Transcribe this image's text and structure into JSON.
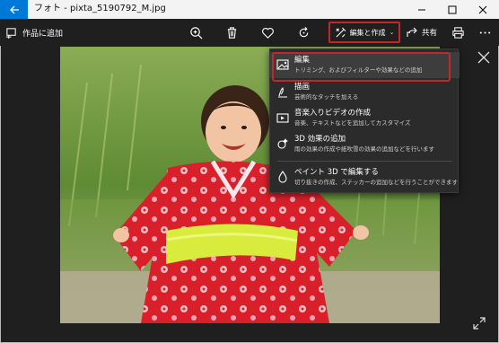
{
  "window": {
    "title": "フォト - pixta_5190792_M.jpg",
    "controls": [
      "minimize-icon",
      "maximize-icon",
      "close-icon"
    ]
  },
  "toolbar": {
    "add_to_album_label": "作品に追加",
    "icons": [
      "zoom-in-icon",
      "delete-icon",
      "favorite-heart-icon",
      "rotate-icon",
      "print-icon",
      "more-icon"
    ],
    "edit_create_label": "編集と作成",
    "share_label": "共有"
  },
  "menu": {
    "items": [
      {
        "title": "編集",
        "description": "トリミング、およびフィルターや効果などの追加",
        "icon": "edit-image-icon"
      },
      {
        "title": "描画",
        "description": "芸術的なタッチを加える",
        "icon": "draw-pen-icon"
      },
      {
        "title": "音楽入りビデオの作成",
        "description": "音楽、テキストなどを追加してカスタマイズ",
        "icon": "video-icon"
      },
      {
        "title": "3D 効果の追加",
        "description": "雨の効果の作成や紙吹雪の効果の追加などを行います",
        "icon": "3d-effects-icon"
      },
      {
        "title": "ペイント 3D で編集する",
        "description": "切り抜きの作成、ステッカーの追加などを行うことができます",
        "icon": "paint-3d-icon"
      }
    ]
  },
  "colors": {
    "accent_blue": "#0078d7",
    "highlight_red": "#c4262e",
    "app_background": "#1f1f1f",
    "menu_background": "#2b2b2b"
  }
}
